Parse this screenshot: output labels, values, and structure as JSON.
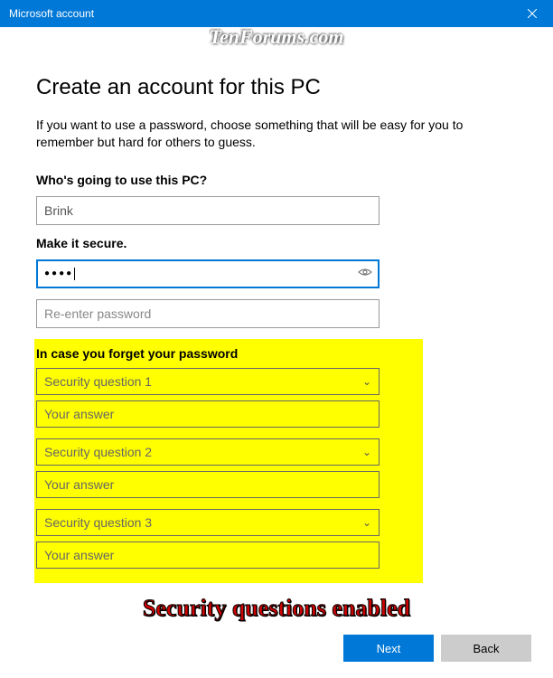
{
  "window": {
    "title": "Microsoft account"
  },
  "watermark": "TenForums.com",
  "page": {
    "heading": "Create an account for this PC",
    "subtext": "If you want to use a password, choose something that will be easy for you to remember but hard for others to guess."
  },
  "user_section": {
    "label": "Who's going to use this PC?",
    "username_value": "Brink"
  },
  "password_section": {
    "label": "Make it secure.",
    "password_masked": "●●●●",
    "reenter_placeholder": "Re-enter password"
  },
  "security_section": {
    "label": "In case you forget your password",
    "q1_placeholder": "Security question 1",
    "a1_placeholder": "Your answer",
    "q2_placeholder": "Security question 2",
    "a2_placeholder": "Your answer",
    "q3_placeholder": "Security question 3",
    "a3_placeholder": "Your answer"
  },
  "annotation": "Security questions enabled",
  "footer": {
    "next_label": "Next",
    "back_label": "Back"
  }
}
